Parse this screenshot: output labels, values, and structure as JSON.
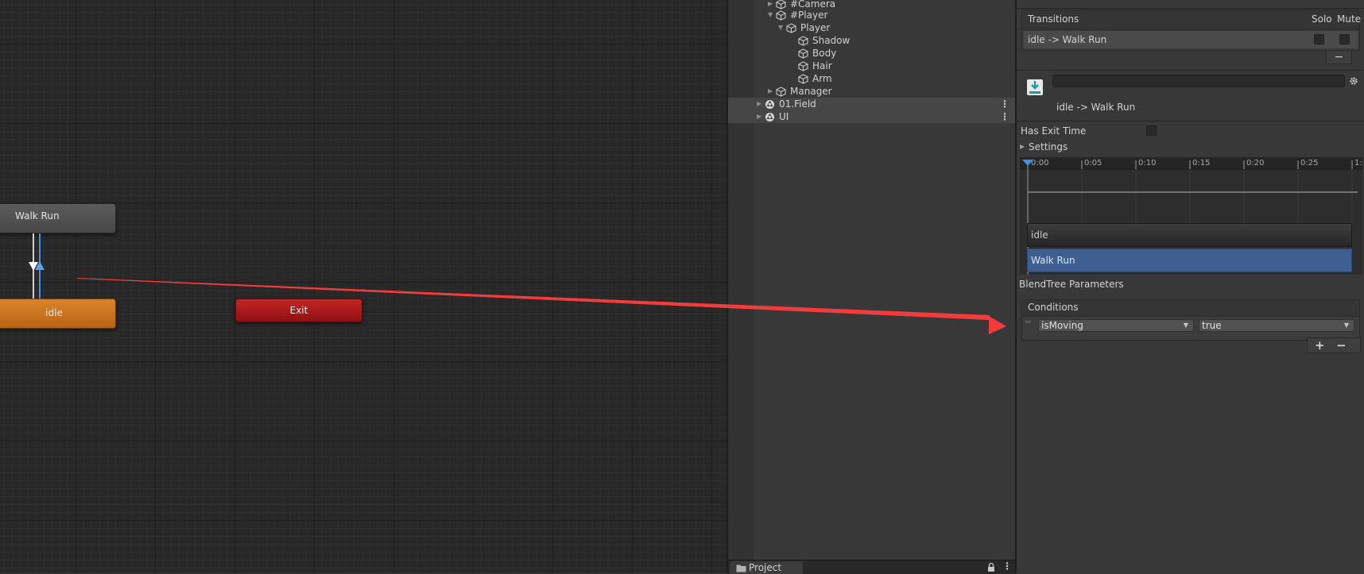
{
  "graph": {
    "nodes": {
      "walk_run": "Walk Run",
      "idle": "idle",
      "exit": "Exit"
    }
  },
  "hierarchy": {
    "items": [
      {
        "label": "#Camera"
      },
      {
        "label": "#Player"
      },
      {
        "label": "Player"
      },
      {
        "label": "Shadow"
      },
      {
        "label": "Body"
      },
      {
        "label": "Hair"
      },
      {
        "label": "Arm"
      },
      {
        "label": "Manager"
      },
      {
        "label": "01.Field"
      },
      {
        "label": "UI"
      }
    ],
    "project_tab": "Project"
  },
  "inspector": {
    "transitions": {
      "header": "Transitions",
      "solo": "Solo",
      "mute": "Mute",
      "row_label": "idle -> Walk Run",
      "remove_label": "−"
    },
    "transition_title": "idle -> Walk Run",
    "has_exit_time_label": "Has Exit Time",
    "settings_label": "Settings",
    "timeline": {
      "ticks": [
        "0:00",
        "0:05",
        "0:10",
        "0:15",
        "0:20",
        "0:25",
        "1:"
      ],
      "clip_from": "idle",
      "clip_to": "Walk Run"
    },
    "blendtree_label": "BlendTree Parameters",
    "conditions": {
      "header": "Conditions",
      "parameter": "isMoving",
      "value": "true",
      "add_label": "+",
      "remove_label": "−"
    }
  },
  "colors": {
    "idle_node": "#c8731e",
    "exit_node": "#a81818",
    "annotation_arrow": "#f23c3c",
    "walk_clip": "#3e5f8f"
  }
}
